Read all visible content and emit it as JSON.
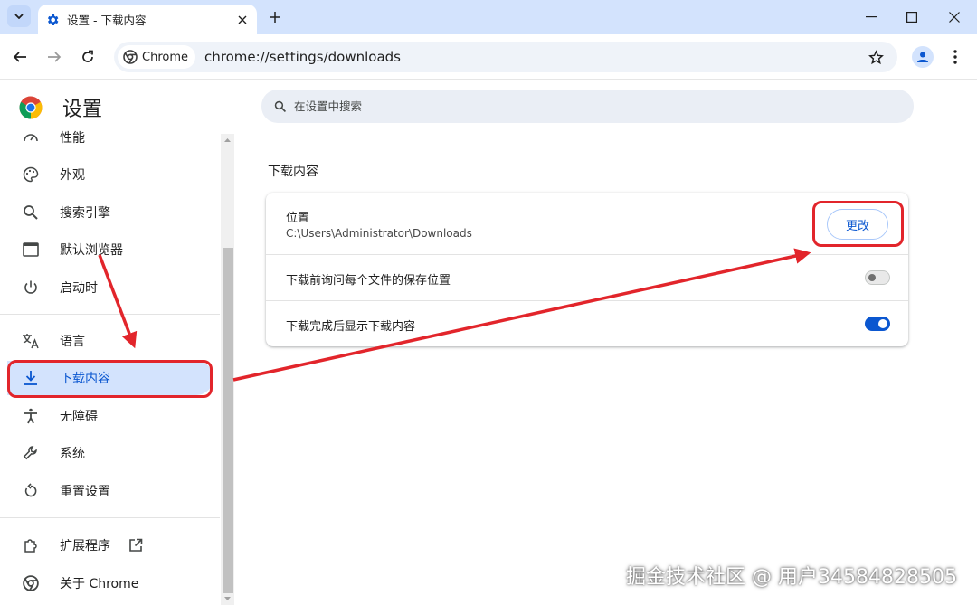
{
  "browser": {
    "tab_title": "设置 - 下载内容",
    "chip_label": "Chrome",
    "url": "chrome://settings/downloads"
  },
  "sidebar": {
    "title": "设置",
    "items": [
      {
        "label": "性能",
        "icon": "speedometer-icon"
      },
      {
        "label": "外观",
        "icon": "palette-icon"
      },
      {
        "label": "搜索引擎",
        "icon": "search-icon"
      },
      {
        "label": "默认浏览器",
        "icon": "browser-window-icon"
      },
      {
        "label": "启动时",
        "icon": "power-icon"
      },
      {
        "label": "语言",
        "icon": "translate-icon"
      },
      {
        "label": "下载内容",
        "icon": "download-icon",
        "active": true
      },
      {
        "label": "无障碍",
        "icon": "accessibility-icon"
      },
      {
        "label": "系统",
        "icon": "wrench-icon"
      },
      {
        "label": "重置设置",
        "icon": "reset-icon"
      },
      {
        "label": "扩展程序",
        "icon": "puzzle-icon"
      },
      {
        "label": "关于 Chrome",
        "icon": "chrome-icon"
      }
    ]
  },
  "search": {
    "placeholder": "在设置中搜索"
  },
  "downloads": {
    "section_title": "下载内容",
    "location_label": "位置",
    "location_path": "C:\\Users\\Administrator\\Downloads",
    "change_button": "更改",
    "ask_label": "下载前询问每个文件的保存位置",
    "ask_enabled": false,
    "show_label": "下载完成后显示下载内容",
    "show_enabled": true
  },
  "watermark": "掘金技术社区 @ 用户34584828505",
  "colors": {
    "accent": "#0b57d0",
    "active_bg": "#d3e3fd",
    "annotation": "#e2252b"
  }
}
